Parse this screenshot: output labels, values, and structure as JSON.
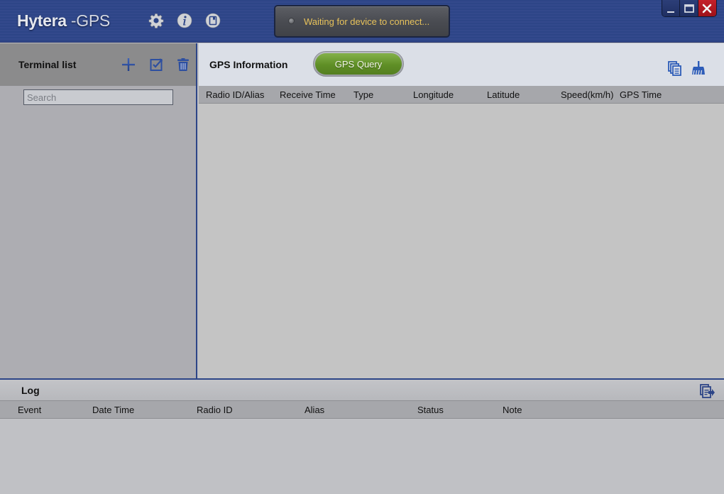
{
  "app": {
    "brand": "Hytera",
    "suffix": " -GPS",
    "toolbar_icons": [
      "gear-icon",
      "info-icon",
      "book-icon"
    ]
  },
  "status": {
    "text": "Waiting for device to connect..."
  },
  "window_controls": {
    "minimize": "minimize",
    "maximize": "maximize",
    "close": "close"
  },
  "terminal_list": {
    "title": "Terminal list",
    "search_placeholder": "Search",
    "search_value": "",
    "actions": [
      "add",
      "edit",
      "delete"
    ]
  },
  "gps_info": {
    "title": "GPS Information",
    "query_button": "GPS Query",
    "columns": [
      "Radio ID/Alias",
      "Receive Time",
      "Type",
      "Longitude",
      "Latitude",
      "Speed(km/h)",
      "GPS Time"
    ],
    "rows": []
  },
  "log": {
    "title": "Log",
    "columns": [
      "Event",
      "Date Time",
      "Radio ID",
      "Alias",
      "Status",
      "Note"
    ],
    "rows": []
  },
  "colors": {
    "titlebar": "#2d4587",
    "status_text": "#e8c25a",
    "query_button": "#6f9e33",
    "close_button": "#c5202a",
    "icon_blue": "#2f4f9e"
  }
}
